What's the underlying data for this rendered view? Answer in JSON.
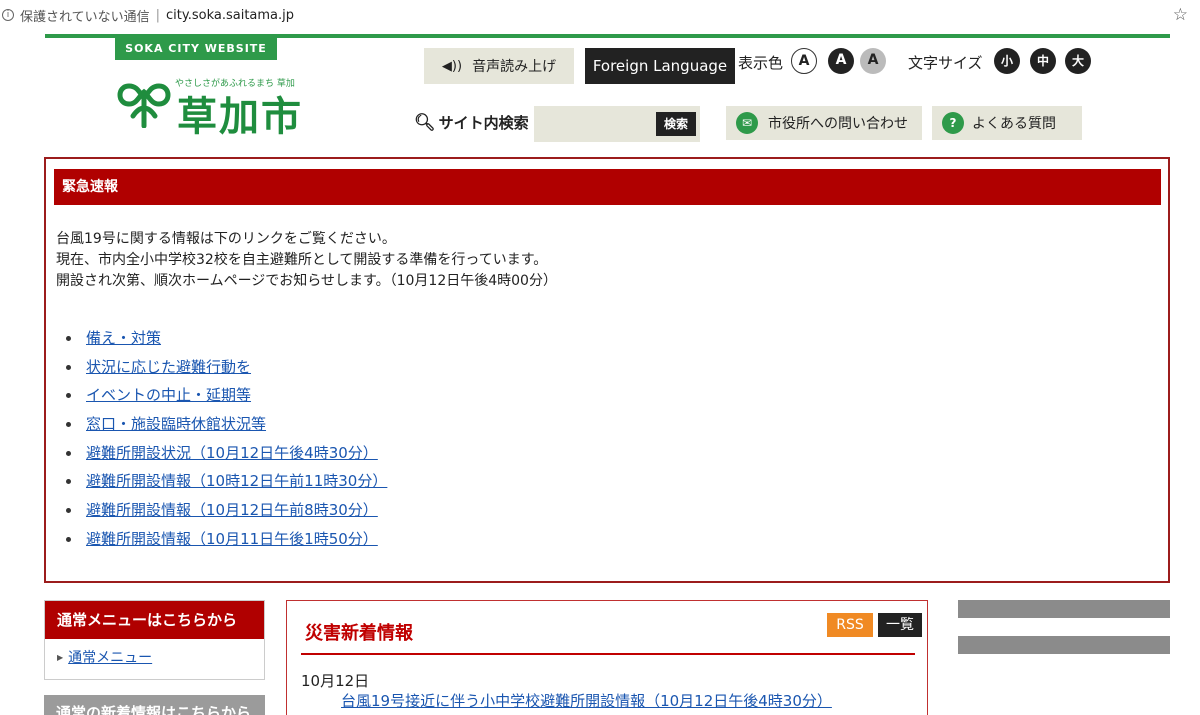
{
  "browser": {
    "security_text": "保護されていない通信",
    "separator": "|",
    "url": "city.soka.saitama.jp"
  },
  "header": {
    "site_badge": "SOKA CITY WEBSITE",
    "logo_catch": "やさしさがあふれるまち 草加",
    "logo_name": "草加市",
    "voice_button": "音声読み上げ",
    "language_button": "Foreign Language",
    "color_label": "表示色",
    "color_options": [
      "A",
      "A",
      "A"
    ],
    "size_label": "文字サイズ",
    "size_options": [
      "小",
      "中",
      "大"
    ],
    "search_label": "サイト内検索",
    "search_value": "",
    "search_button": "検索",
    "contact_button": "市役所への問い合わせ",
    "faq_button": "よくある質問"
  },
  "emergency": {
    "heading": "緊急速報",
    "lines": [
      "台風19号に関する情報は下のリンクをご覧ください。",
      "現在、市内全小中学校32校を自主避難所として開設する準備を行っています。",
      "開設され次第、順次ホームページでお知らせします。（10月12日午後4時00分）"
    ],
    "links": [
      "備え・対策",
      "状況に応じた避難行動を",
      "イベントの中止・延期等",
      "窓口・施設臨時休館状況等",
      "避難所開設状況（10月12日午後4時30分）",
      "避難所開設情報（10時12日午前11時30分）",
      "避難所開設情報（10月12日午前8時30分）",
      "避難所開設情報（10月11日午後1時50分）"
    ]
  },
  "menu": {
    "heading": "通常メニューはこちらから",
    "item": "通常メニュー",
    "heading2": "通常の新着情報はこちらから"
  },
  "news": {
    "title": "災害新着情報",
    "rss": "RSS",
    "list_button": "一覧",
    "date": "10月12日",
    "item": "台風19号接近に伴う小中学校避難所開設情報（10月12日午後4時30分）"
  },
  "colors": {
    "green": "#2e9a4a",
    "emergency_red": "#b00000",
    "link": "#1a56b0",
    "rss_orange": "#f08a24"
  }
}
